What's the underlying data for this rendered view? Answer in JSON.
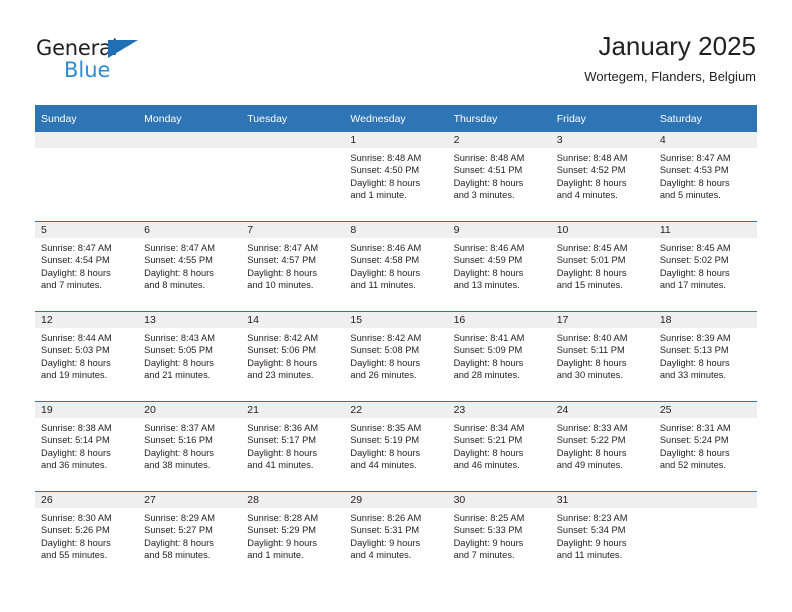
{
  "brand": {
    "name_part1": "General",
    "name_part2": "Blue",
    "triangle_color": "#1f6fb5",
    "blue_color": "#2e8bd4"
  },
  "header": {
    "title": "January 2025",
    "subtitle": "Wortegem, Flanders, Belgium"
  },
  "theme": {
    "header_blue": "#2e75b6",
    "daynum_band": "#efefef",
    "text": "#231f20"
  },
  "weekday_headers": [
    "Sunday",
    "Monday",
    "Tuesday",
    "Wednesday",
    "Thursday",
    "Friday",
    "Saturday"
  ],
  "labels": {
    "sunrise_prefix": "Sunrise:",
    "sunset_prefix": "Sunset:",
    "daylight_prefix": "Daylight:"
  },
  "weeks": [
    [
      {
        "day": "",
        "sunrise": "",
        "sunset": "",
        "daylight_line1": "",
        "daylight_line2": ""
      },
      {
        "day": "",
        "sunrise": "",
        "sunset": "",
        "daylight_line1": "",
        "daylight_line2": ""
      },
      {
        "day": "",
        "sunrise": "",
        "sunset": "",
        "daylight_line1": "",
        "daylight_line2": ""
      },
      {
        "day": "1",
        "sunrise": "Sunrise: 8:48 AM",
        "sunset": "Sunset: 4:50 PM",
        "daylight_line1": "Daylight: 8 hours",
        "daylight_line2": "and 1 minute."
      },
      {
        "day": "2",
        "sunrise": "Sunrise: 8:48 AM",
        "sunset": "Sunset: 4:51 PM",
        "daylight_line1": "Daylight: 8 hours",
        "daylight_line2": "and 3 minutes."
      },
      {
        "day": "3",
        "sunrise": "Sunrise: 8:48 AM",
        "sunset": "Sunset: 4:52 PM",
        "daylight_line1": "Daylight: 8 hours",
        "daylight_line2": "and 4 minutes."
      },
      {
        "day": "4",
        "sunrise": "Sunrise: 8:47 AM",
        "sunset": "Sunset: 4:53 PM",
        "daylight_line1": "Daylight: 8 hours",
        "daylight_line2": "and 5 minutes."
      }
    ],
    [
      {
        "day": "5",
        "sunrise": "Sunrise: 8:47 AM",
        "sunset": "Sunset: 4:54 PM",
        "daylight_line1": "Daylight: 8 hours",
        "daylight_line2": "and 7 minutes."
      },
      {
        "day": "6",
        "sunrise": "Sunrise: 8:47 AM",
        "sunset": "Sunset: 4:55 PM",
        "daylight_line1": "Daylight: 8 hours",
        "daylight_line2": "and 8 minutes."
      },
      {
        "day": "7",
        "sunrise": "Sunrise: 8:47 AM",
        "sunset": "Sunset: 4:57 PM",
        "daylight_line1": "Daylight: 8 hours",
        "daylight_line2": "and 10 minutes."
      },
      {
        "day": "8",
        "sunrise": "Sunrise: 8:46 AM",
        "sunset": "Sunset: 4:58 PM",
        "daylight_line1": "Daylight: 8 hours",
        "daylight_line2": "and 11 minutes."
      },
      {
        "day": "9",
        "sunrise": "Sunrise: 8:46 AM",
        "sunset": "Sunset: 4:59 PM",
        "daylight_line1": "Daylight: 8 hours",
        "daylight_line2": "and 13 minutes."
      },
      {
        "day": "10",
        "sunrise": "Sunrise: 8:45 AM",
        "sunset": "Sunset: 5:01 PM",
        "daylight_line1": "Daylight: 8 hours",
        "daylight_line2": "and 15 minutes."
      },
      {
        "day": "11",
        "sunrise": "Sunrise: 8:45 AM",
        "sunset": "Sunset: 5:02 PM",
        "daylight_line1": "Daylight: 8 hours",
        "daylight_line2": "and 17 minutes."
      }
    ],
    [
      {
        "day": "12",
        "sunrise": "Sunrise: 8:44 AM",
        "sunset": "Sunset: 5:03 PM",
        "daylight_line1": "Daylight: 8 hours",
        "daylight_line2": "and 19 minutes."
      },
      {
        "day": "13",
        "sunrise": "Sunrise: 8:43 AM",
        "sunset": "Sunset: 5:05 PM",
        "daylight_line1": "Daylight: 8 hours",
        "daylight_line2": "and 21 minutes."
      },
      {
        "day": "14",
        "sunrise": "Sunrise: 8:42 AM",
        "sunset": "Sunset: 5:06 PM",
        "daylight_line1": "Daylight: 8 hours",
        "daylight_line2": "and 23 minutes."
      },
      {
        "day": "15",
        "sunrise": "Sunrise: 8:42 AM",
        "sunset": "Sunset: 5:08 PM",
        "daylight_line1": "Daylight: 8 hours",
        "daylight_line2": "and 26 minutes."
      },
      {
        "day": "16",
        "sunrise": "Sunrise: 8:41 AM",
        "sunset": "Sunset: 5:09 PM",
        "daylight_line1": "Daylight: 8 hours",
        "daylight_line2": "and 28 minutes."
      },
      {
        "day": "17",
        "sunrise": "Sunrise: 8:40 AM",
        "sunset": "Sunset: 5:11 PM",
        "daylight_line1": "Daylight: 8 hours",
        "daylight_line2": "and 30 minutes."
      },
      {
        "day": "18",
        "sunrise": "Sunrise: 8:39 AM",
        "sunset": "Sunset: 5:13 PM",
        "daylight_line1": "Daylight: 8 hours",
        "daylight_line2": "and 33 minutes."
      }
    ],
    [
      {
        "day": "19",
        "sunrise": "Sunrise: 8:38 AM",
        "sunset": "Sunset: 5:14 PM",
        "daylight_line1": "Daylight: 8 hours",
        "daylight_line2": "and 36 minutes."
      },
      {
        "day": "20",
        "sunrise": "Sunrise: 8:37 AM",
        "sunset": "Sunset: 5:16 PM",
        "daylight_line1": "Daylight: 8 hours",
        "daylight_line2": "and 38 minutes."
      },
      {
        "day": "21",
        "sunrise": "Sunrise: 8:36 AM",
        "sunset": "Sunset: 5:17 PM",
        "daylight_line1": "Daylight: 8 hours",
        "daylight_line2": "and 41 minutes."
      },
      {
        "day": "22",
        "sunrise": "Sunrise: 8:35 AM",
        "sunset": "Sunset: 5:19 PM",
        "daylight_line1": "Daylight: 8 hours",
        "daylight_line2": "and 44 minutes."
      },
      {
        "day": "23",
        "sunrise": "Sunrise: 8:34 AM",
        "sunset": "Sunset: 5:21 PM",
        "daylight_line1": "Daylight: 8 hours",
        "daylight_line2": "and 46 minutes."
      },
      {
        "day": "24",
        "sunrise": "Sunrise: 8:33 AM",
        "sunset": "Sunset: 5:22 PM",
        "daylight_line1": "Daylight: 8 hours",
        "daylight_line2": "and 49 minutes."
      },
      {
        "day": "25",
        "sunrise": "Sunrise: 8:31 AM",
        "sunset": "Sunset: 5:24 PM",
        "daylight_line1": "Daylight: 8 hours",
        "daylight_line2": "and 52 minutes."
      }
    ],
    [
      {
        "day": "26",
        "sunrise": "Sunrise: 8:30 AM",
        "sunset": "Sunset: 5:26 PM",
        "daylight_line1": "Daylight: 8 hours",
        "daylight_line2": "and 55 minutes."
      },
      {
        "day": "27",
        "sunrise": "Sunrise: 8:29 AM",
        "sunset": "Sunset: 5:27 PM",
        "daylight_line1": "Daylight: 8 hours",
        "daylight_line2": "and 58 minutes."
      },
      {
        "day": "28",
        "sunrise": "Sunrise: 8:28 AM",
        "sunset": "Sunset: 5:29 PM",
        "daylight_line1": "Daylight: 9 hours",
        "daylight_line2": "and 1 minute."
      },
      {
        "day": "29",
        "sunrise": "Sunrise: 8:26 AM",
        "sunset": "Sunset: 5:31 PM",
        "daylight_line1": "Daylight: 9 hours",
        "daylight_line2": "and 4 minutes."
      },
      {
        "day": "30",
        "sunrise": "Sunrise: 8:25 AM",
        "sunset": "Sunset: 5:33 PM",
        "daylight_line1": "Daylight: 9 hours",
        "daylight_line2": "and 7 minutes."
      },
      {
        "day": "31",
        "sunrise": "Sunrise: 8:23 AM",
        "sunset": "Sunset: 5:34 PM",
        "daylight_line1": "Daylight: 9 hours",
        "daylight_line2": "and 11 minutes."
      },
      {
        "day": "",
        "sunrise": "",
        "sunset": "",
        "daylight_line1": "",
        "daylight_line2": ""
      }
    ]
  ]
}
